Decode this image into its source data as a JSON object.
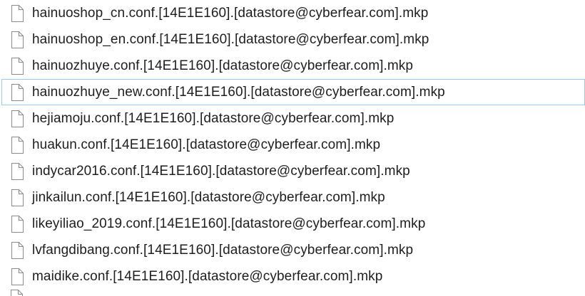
{
  "files": [
    {
      "name": "hainuoshop_cn.conf.[14E1E160].[datastore@cyberfear.com].mkp",
      "icon": "file-icon",
      "focused": false
    },
    {
      "name": "hainuoshop_en.conf.[14E1E160].[datastore@cyberfear.com].mkp",
      "icon": "file-icon",
      "focused": false
    },
    {
      "name": "hainuozhuye.conf.[14E1E160].[datastore@cyberfear.com].mkp",
      "icon": "file-icon",
      "focused": false
    },
    {
      "name": "hainuozhuye_new.conf.[14E1E160].[datastore@cyberfear.com].mkp",
      "icon": "file-icon",
      "focused": true
    },
    {
      "name": "hejiamoju.conf.[14E1E160].[datastore@cyberfear.com].mkp",
      "icon": "file-icon",
      "focused": false
    },
    {
      "name": "huakun.conf.[14E1E160].[datastore@cyberfear.com].mkp",
      "icon": "file-icon",
      "focused": false
    },
    {
      "name": "indycar2016.conf.[14E1E160].[datastore@cyberfear.com].mkp",
      "icon": "file-icon",
      "focused": false
    },
    {
      "name": "jinkailun.conf.[14E1E160].[datastore@cyberfear.com].mkp",
      "icon": "file-icon",
      "focused": false
    },
    {
      "name": "likeyiliao_2019.conf.[14E1E160].[datastore@cyberfear.com].mkp",
      "icon": "file-icon",
      "focused": false
    },
    {
      "name": "lvfangdibang.conf.[14E1E160].[datastore@cyberfear.com].mkp",
      "icon": "file-icon",
      "focused": false
    },
    {
      "name": "maidike.conf.[14E1E160].[datastore@cyberfear.com].mkp",
      "icon": "file-icon",
      "focused": false
    }
  ],
  "colors": {
    "text": "#1e1e1e",
    "focus_border": "#99c9ef",
    "icon_stroke": "#8a8a8a",
    "icon_fill": "#ffffff"
  }
}
